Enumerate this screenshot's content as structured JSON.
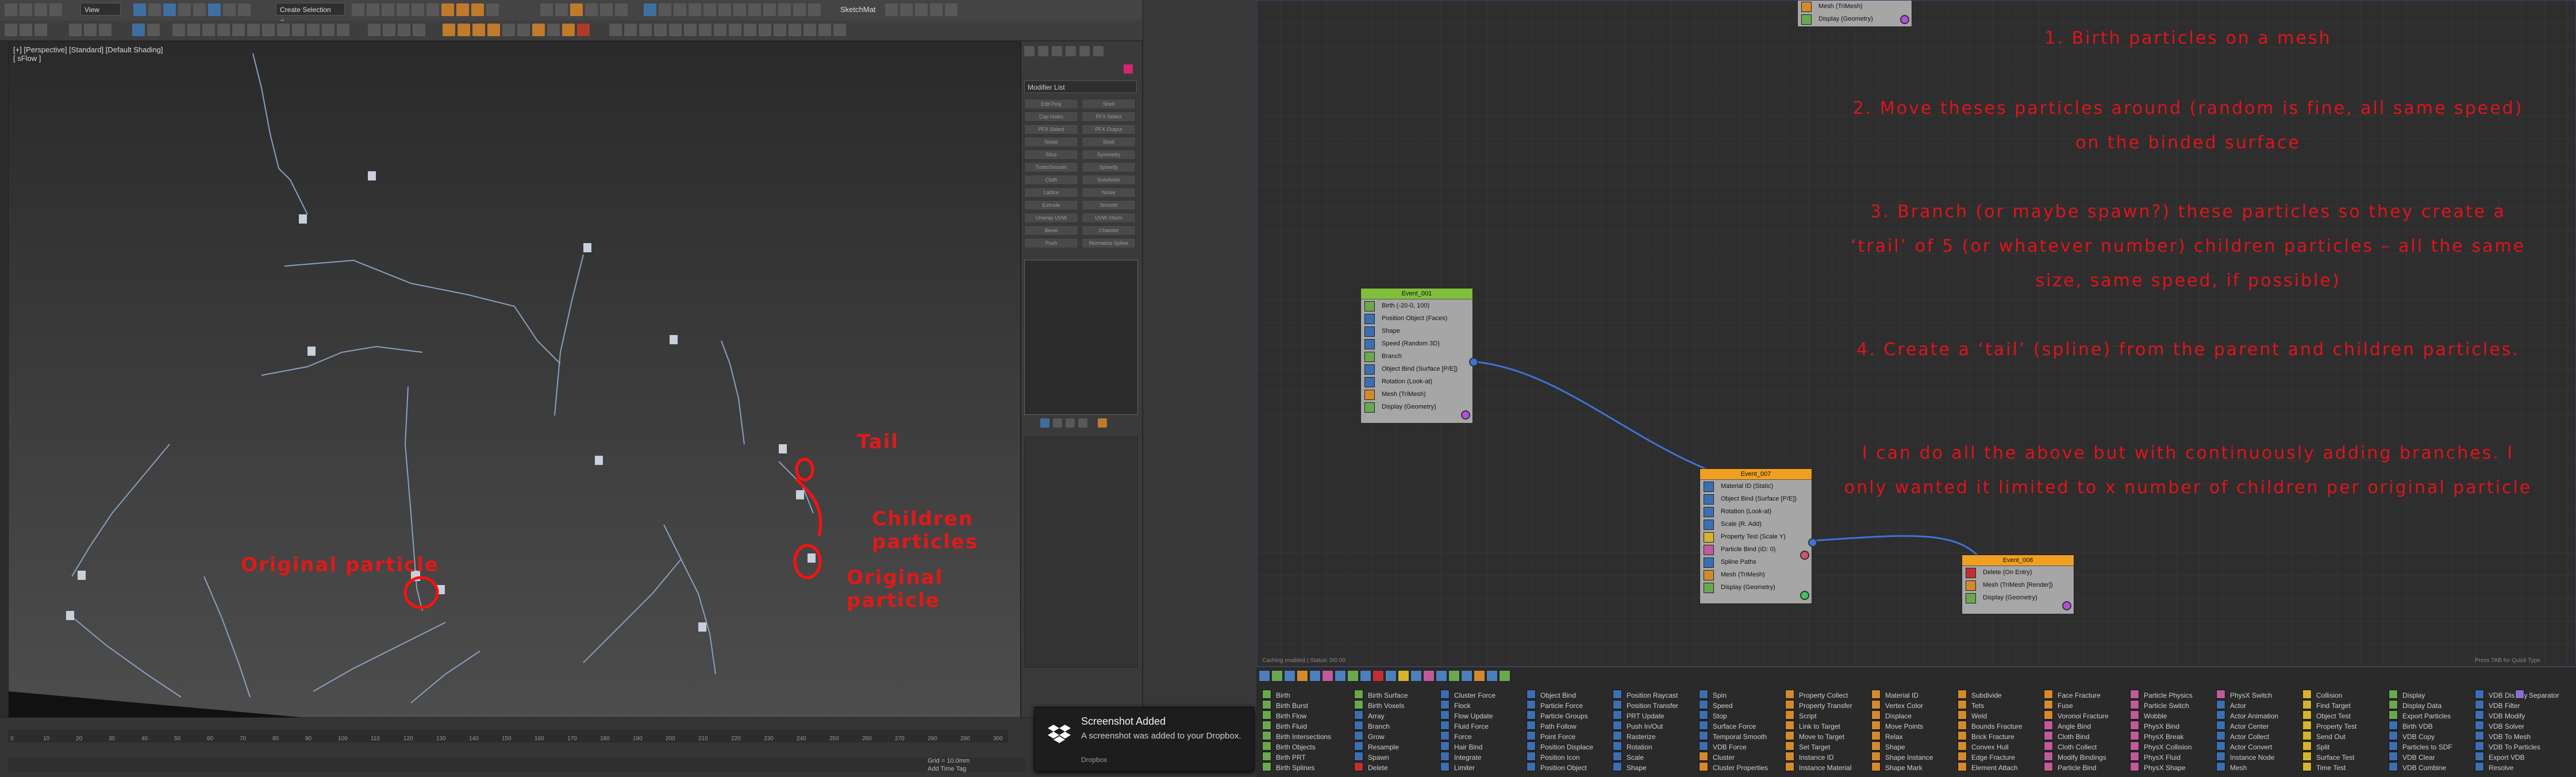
{
  "app": {
    "title_dropdown": "Create Selection Se",
    "view_dropdown": "View",
    "sketchup": "SketchMat"
  },
  "viewport": {
    "label_line1": "[+] [Perspective] [Standard] [Default Shading]",
    "label_line2": "[ sFlow ]"
  },
  "annotations": {
    "tail": "Tail",
    "children": "Children particles",
    "original_left": "Original particle",
    "original_right": "Original particle"
  },
  "command_panel": {
    "modifier_list": "Modifier List",
    "buttons": [
      "Edit Poly",
      "Shell",
      "Cap Holes",
      "PFX Select",
      "PFX Select",
      "PFX Output",
      "Noise",
      "Shell",
      "Slice",
      "Symmetry",
      "TurboSmooth",
      "Spherify",
      "Cloth",
      "Subdivide",
      "Lattice",
      "Noise",
      "Extrude",
      "Smooth",
      "Unwrap UVW",
      "UVW Xform",
      "Bevel",
      "Chamfer",
      "Push",
      "Normalize Spline"
    ]
  },
  "timeline": {
    "ticks": [
      "0",
      "10",
      "20",
      "30",
      "40",
      "50",
      "60",
      "70",
      "80",
      "90",
      "100",
      "110",
      "120",
      "130",
      "140",
      "150",
      "160",
      "170",
      "180",
      "190",
      "200",
      "210",
      "220",
      "230",
      "240",
      "250",
      "260",
      "270",
      "280",
      "290",
      "300"
    ],
    "grid": "Grid = 10.0mm",
    "add_time_tag": "Add Time Tag"
  },
  "notification": {
    "title": "Screenshot Added",
    "body": "A screenshot was added to your Dropbox.",
    "source": "Dropbox"
  },
  "notes": {
    "n1": "1. Birth particles on a mesh",
    "n2_a": "2. Move theses particles around (random is fine, all same speed)",
    "n2_b": "on the binded surface",
    "n3_a": "3. Branch (or maybe spawn?) these particles so they create a",
    "n3_b": "‘trail’ of 5 (or whatever number) children particles – all the same",
    "n3_c": "size, same speed, if possible)",
    "n4": "4. Create a ‘tail’ (spline) from the parent and children particles.",
    "n5_a": "I can do all the above but with continuously adding branches. I",
    "n5_b": "only wanted it limited to x number of children per original particle"
  },
  "nodes": {
    "top_partial": {
      "ops": [
        "Mesh (TriMesh)",
        "Display (Geometry)"
      ]
    },
    "event_001": {
      "title": "Event_001",
      "ops": [
        "Birth (-20-0, 100)",
        "Position Object (Faces)",
        "Shape",
        "Speed (Random 3D)",
        "Branch",
        "Object Bind (Surface [P/E])",
        "Rotation (Look-at)",
        "Mesh (TriMesh)",
        "Display (Geometry)"
      ]
    },
    "event_007": {
      "title": "Event_007",
      "ops": [
        "Material ID (Static)",
        "Object Bind (Surface [P/E])",
        "Rotation (Look-at)",
        "Scale (R. Add)",
        "Property Test (Scale Y)",
        "Particle Bind (ID: 0)",
        "Spline Paths",
        "Mesh (TriMesh)",
        "Display (Geometry)"
      ]
    },
    "event_008": {
      "title": "Event_008",
      "ops": [
        "Delete (On Entry)",
        "Mesh (TriMesh [Render])",
        "Display (Geometry)"
      ]
    }
  },
  "editor_status_left": "Caching enabled | Status: 0/0 00",
  "editor_status_right": "Press TAB for Quick Type",
  "depot": {
    "col1": [
      "Birth",
      "Birth Burst",
      "Birth Flow",
      "Birth Fluid",
      "Birth Intersections",
      "Birth Objects",
      "Birth PRT",
      "Birth Splines"
    ],
    "col2": [
      "Birth Surface",
      "Birth Voxels",
      "Array",
      "Branch",
      "Grow",
      "Resample",
      "Spawn",
      "Delete"
    ],
    "col3": [
      "Cluster Force",
      "Flock",
      "Flow Update",
      "Fluid Force",
      "Force",
      "Hair Bind",
      "Integrate",
      "Limiter"
    ],
    "col4": [
      "Object Bind",
      "Particle Force",
      "Particle Groups",
      "Path Follow",
      "Point Force",
      "Position Displace",
      "Position Icon",
      "Position Object"
    ],
    "col5": [
      "Position Raycast",
      "Position Transfer",
      "PRT Update",
      "Push In/Out",
      "Rasterize",
      "Rotation",
      "Scale",
      "Shape"
    ],
    "col6": [
      "Spin",
      "Speed",
      "Stop",
      "Surface Force",
      "Temporal Smooth",
      "VDB Force",
      "Cluster",
      "Cluster Properties"
    ],
    "col7": [
      "Property Collect",
      "Property Transfer",
      "Script",
      "Link to Target",
      "Move to Target",
      "Set Target",
      "Instance ID",
      "Instance Material"
    ],
    "col8": [
      "Material ID",
      "Vertex Color",
      "Displace",
      "Move Points",
      "Relax",
      "Shape",
      "Shape Instance",
      "Shape Mark"
    ],
    "col9": [
      "Subdivide",
      "Tets",
      "Weld",
      "Bounds Fracture",
      "Brick Fracture",
      "Convex Hull",
      "Edge Fracture",
      "Element Attach"
    ],
    "col10": [
      "Face Fracture",
      "Fuse",
      "Voronoi Fracture",
      "Angle Bind",
      "Cloth Bind",
      "Cloth Collect",
      "Modify Bindings",
      "Particle Bind"
    ],
    "col11": [
      "Particle Physics",
      "Particle Switch",
      "Wobble",
      "PhysX Bind",
      "PhysX Break",
      "PhysX Collision",
      "PhysX Fluid",
      "PhysX Shape"
    ],
    "col12": [
      "PhysX Switch",
      "Actor",
      "Actor Animation",
      "Actor Center",
      "Actor Collect",
      "Actor Convert",
      "Instance Node",
      "Mesh"
    ],
    "col13": [
      "Collision",
      "Find Target",
      "Object Test",
      "Property Test",
      "Send Out",
      "Split",
      "Surface Test",
      "Time Test"
    ],
    "col14": [
      "Display",
      "Display Data",
      "Export Particles",
      "Birth VDB",
      "VDB Copy",
      "Particles to SDF",
      "VDB Clear",
      "VDB Combine"
    ],
    "col15": [
      "VDB Display",
      "VDB Filter",
      "VDB Modify",
      "VDB Solver",
      "VDB To Mesh",
      "VDB To Particles",
      "Export VDB",
      "Resolve"
    ],
    "col16": [
      "Separator"
    ]
  },
  "colors": {
    "annotation_red": "#e01919",
    "node_header_green": "#7fbf3a",
    "node_header_orange": "#f0a020",
    "wire_blue": "#3d74d6"
  }
}
